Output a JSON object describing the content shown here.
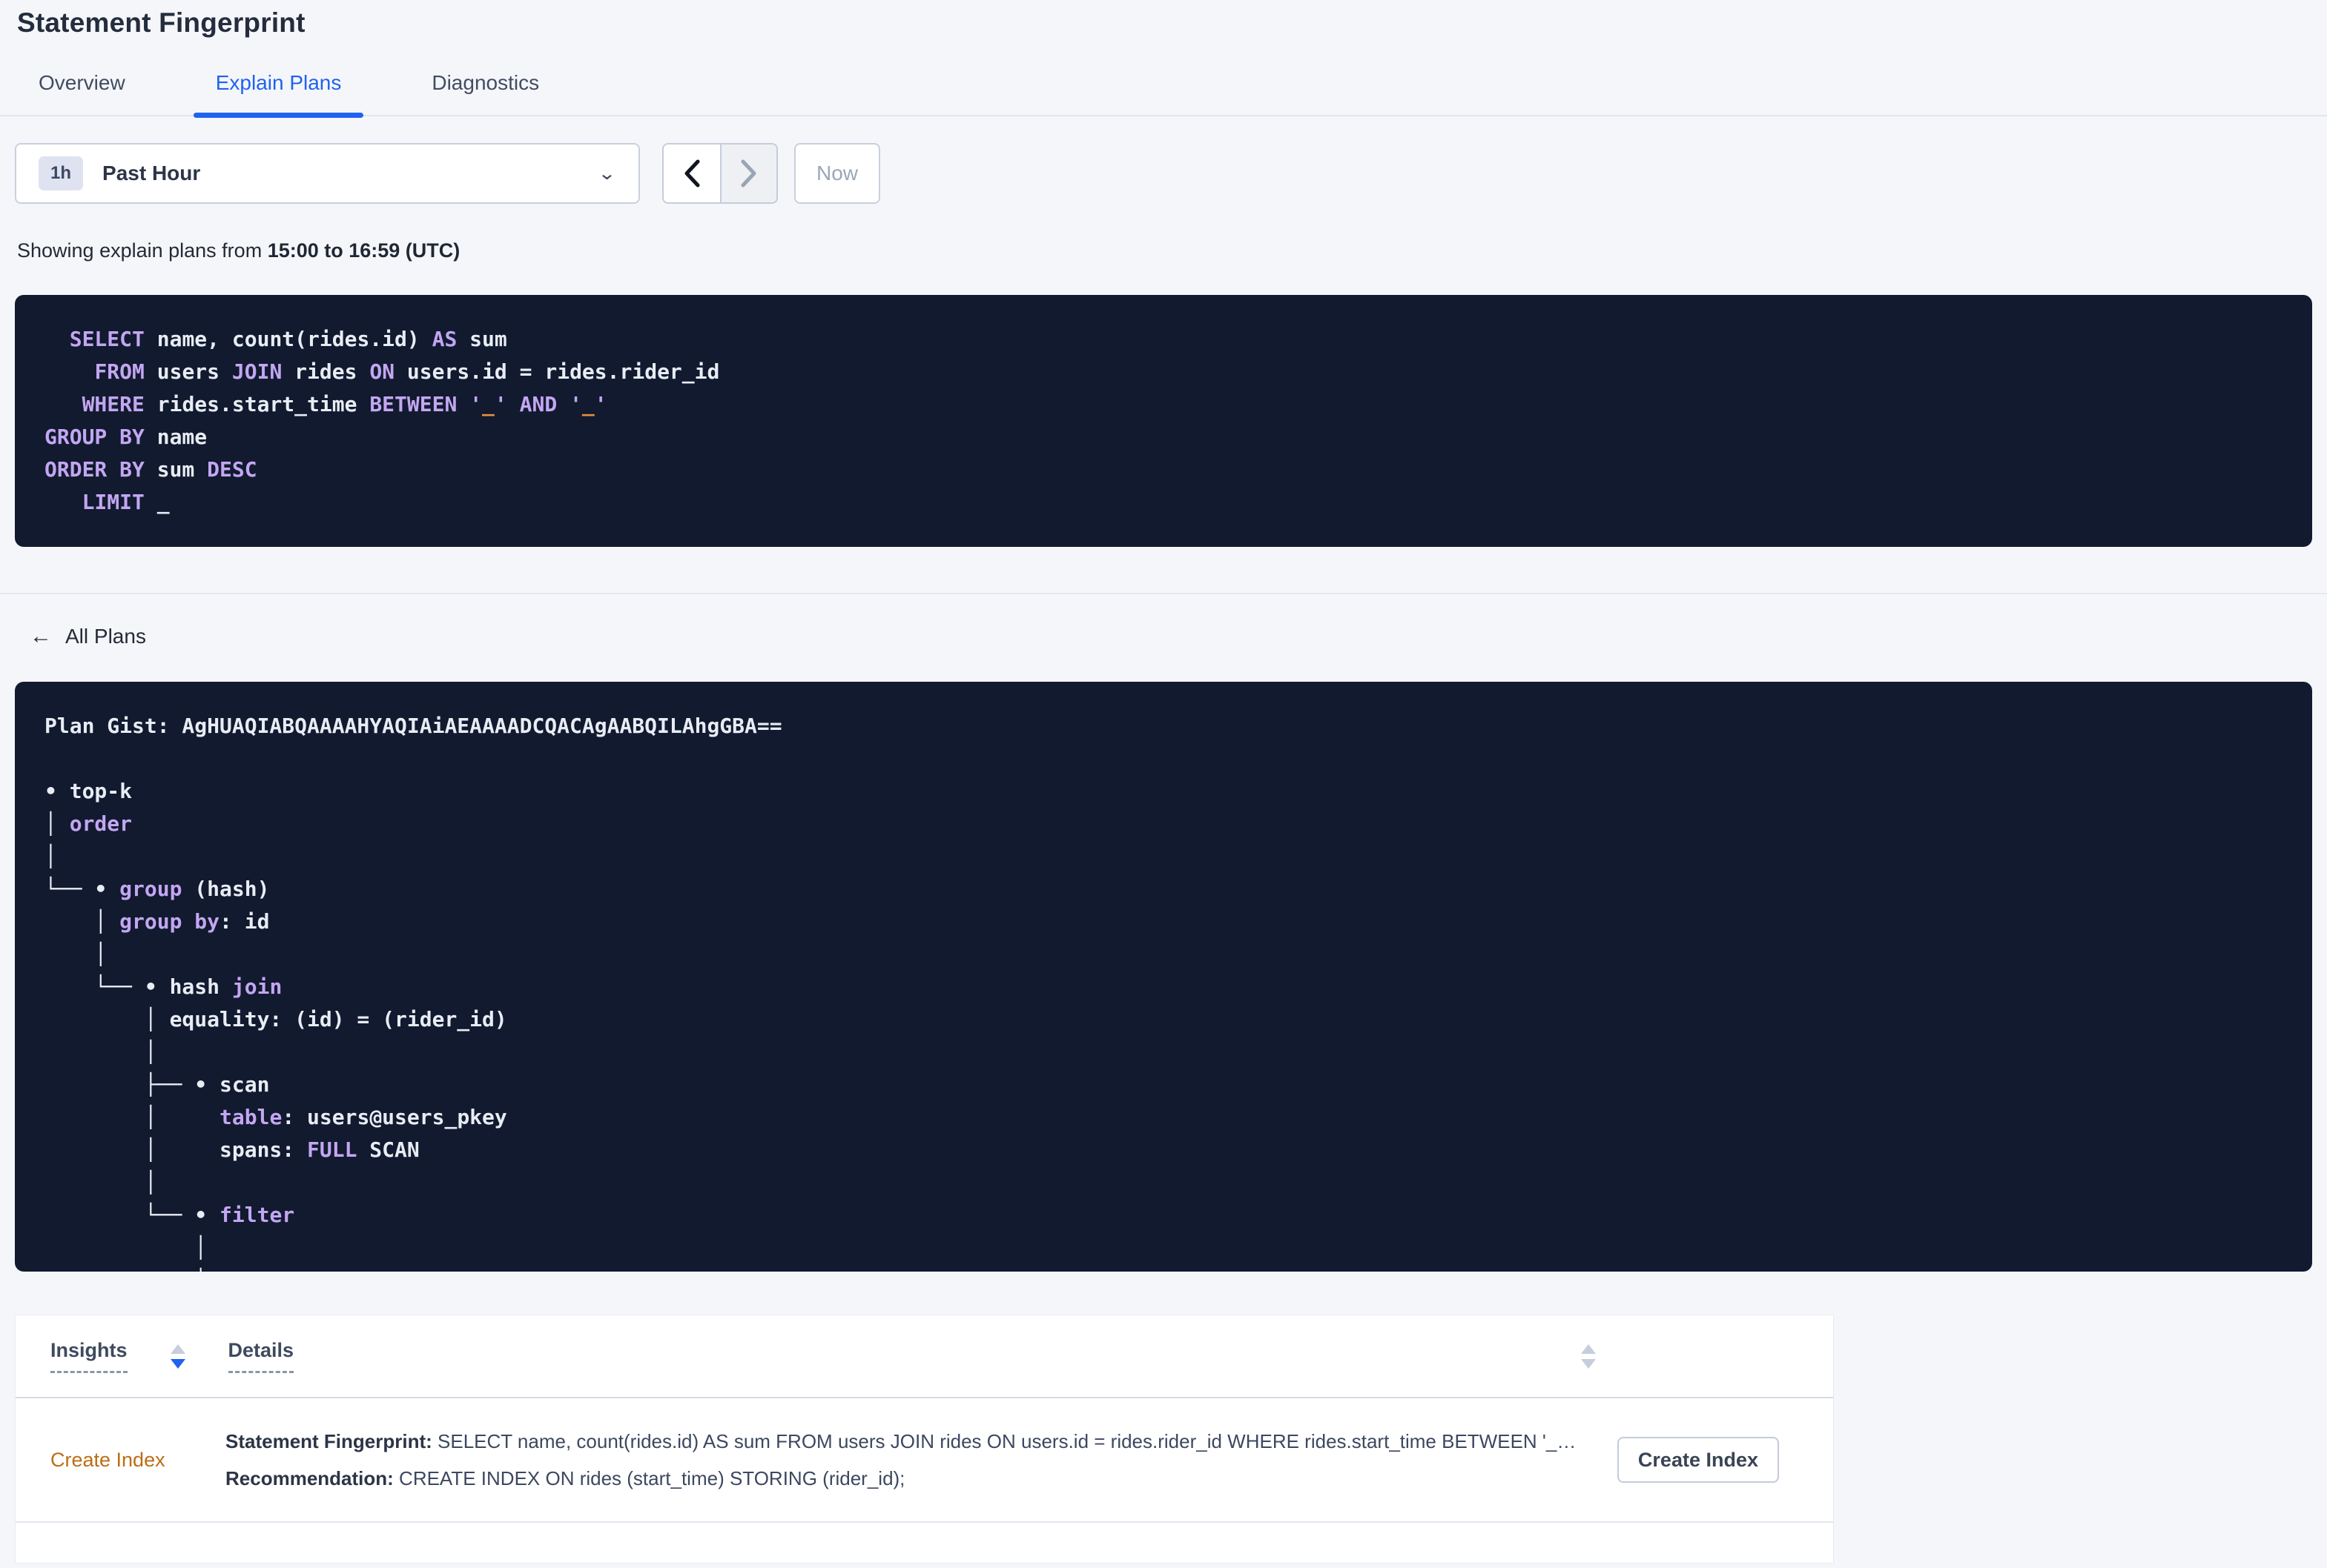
{
  "page_title": "Statement Fingerprint",
  "tabs": [
    {
      "label": "Overview",
      "active": false
    },
    {
      "label": "Explain Plans",
      "active": true
    },
    {
      "label": "Diagnostics",
      "active": false
    }
  ],
  "time_picker": {
    "badge": "1h",
    "label": "Past Hour",
    "now": "Now"
  },
  "showing": {
    "prefix": "Showing explain plans from ",
    "bold": "15:00 to 16:59 (UTC)"
  },
  "sql": {
    "lines": [
      [
        {
          "t": "  ",
          "c": "t"
        },
        {
          "t": "SELECT",
          "c": "k"
        },
        {
          "t": " name, count(rides.id) ",
          "c": "t"
        },
        {
          "t": "AS",
          "c": "k"
        },
        {
          "t": " sum",
          "c": "t"
        }
      ],
      [
        {
          "t": "    ",
          "c": "t"
        },
        {
          "t": "FROM",
          "c": "k"
        },
        {
          "t": " users ",
          "c": "t"
        },
        {
          "t": "JOIN",
          "c": "k"
        },
        {
          "t": " rides ",
          "c": "t"
        },
        {
          "t": "ON",
          "c": "k"
        },
        {
          "t": " users.id = rides.rider_id",
          "c": "t"
        }
      ],
      [
        {
          "t": "   ",
          "c": "t"
        },
        {
          "t": "WHERE",
          "c": "k"
        },
        {
          "t": " rides.start_time ",
          "c": "t"
        },
        {
          "t": "BETWEEN",
          "c": "k"
        },
        {
          "t": " ",
          "c": "t"
        },
        {
          "t": "'",
          "c": "k"
        },
        {
          "t": "_",
          "c": "l"
        },
        {
          "t": "'",
          "c": "k"
        },
        {
          "t": " ",
          "c": "t"
        },
        {
          "t": "AND",
          "c": "k"
        },
        {
          "t": " ",
          "c": "t"
        },
        {
          "t": "'",
          "c": "k"
        },
        {
          "t": "_",
          "c": "l"
        },
        {
          "t": "'",
          "c": "k"
        }
      ],
      [
        {
          "t": "GROUP BY",
          "c": "k"
        },
        {
          "t": " name",
          "c": "t"
        }
      ],
      [
        {
          "t": "ORDER BY",
          "c": "k"
        },
        {
          "t": " sum ",
          "c": "t"
        },
        {
          "t": "DESC",
          "c": "k"
        }
      ],
      [
        {
          "t": "   ",
          "c": "t"
        },
        {
          "t": "LIMIT",
          "c": "k"
        },
        {
          "t": " _",
          "c": "t"
        }
      ]
    ]
  },
  "all_plans": {
    "label": "All Plans",
    "back_icon": "arrow-left"
  },
  "plan": {
    "gist": "AgHUAQIABQAAAAHYAQIAiAEAAAADCQACAgAABQILAhgGBA==",
    "lines": [
      [
        {
          "t": "Plan Gist: AgHUAQIABQAAAAHYAQIAiAEAAAADCQACAgAABQILAhgGBA==",
          "c": "t"
        }
      ],
      [],
      [
        {
          "t": "• top-k",
          "c": "t"
        }
      ],
      [
        {
          "t": "│ ",
          "c": "t"
        },
        {
          "t": "order",
          "c": "k"
        }
      ],
      [
        {
          "t": "│",
          "c": "t"
        }
      ],
      [
        {
          "t": "└── • ",
          "c": "t"
        },
        {
          "t": "group",
          "c": "k"
        },
        {
          "t": " (hash)",
          "c": "t"
        }
      ],
      [
        {
          "t": "    │ ",
          "c": "t"
        },
        {
          "t": "group by",
          "c": "k"
        },
        {
          "t": ": id",
          "c": "t"
        }
      ],
      [
        {
          "t": "    │",
          "c": "t"
        }
      ],
      [
        {
          "t": "    └── • hash ",
          "c": "t"
        },
        {
          "t": "join",
          "c": "k"
        }
      ],
      [
        {
          "t": "        │ equality: (id) = (rider_id)",
          "c": "t"
        }
      ],
      [
        {
          "t": "        │",
          "c": "t"
        }
      ],
      [
        {
          "t": "        ├── • scan",
          "c": "t"
        }
      ],
      [
        {
          "t": "        │     ",
          "c": "t"
        },
        {
          "t": "table",
          "c": "k"
        },
        {
          "t": ": users@users_pkey",
          "c": "t"
        }
      ],
      [
        {
          "t": "        │     spans: ",
          "c": "t"
        },
        {
          "t": "FULL",
          "c": "k"
        },
        {
          "t": " SCAN",
          "c": "t"
        }
      ],
      [
        {
          "t": "        │",
          "c": "t"
        }
      ],
      [
        {
          "t": "        └── • ",
          "c": "t"
        },
        {
          "t": "filter",
          "c": "k"
        }
      ],
      [
        {
          "t": "            │",
          "c": "t"
        }
      ],
      [
        {
          "t": "            │",
          "c": "t"
        }
      ]
    ]
  },
  "insights_table": {
    "columns": [
      {
        "label": "Insights",
        "sort": "desc"
      },
      {
        "label": "Details",
        "sort": "none"
      }
    ],
    "rows": [
      {
        "insight": "Create Index",
        "fingerprint_label": "Statement Fingerprint:",
        "fingerprint": " SELECT name, count(rides.id) AS sum FROM users JOIN rides ON users.id = rides.rider_id WHERE rides.start_time BETWEEN '_…",
        "recommendation_label": "Recommendation:",
        "recommendation": " CREATE INDEX ON rides (start_time) STORING (rider_id);",
        "action": "Create Index"
      }
    ]
  },
  "colors": {
    "accent_blue": "#1f63f0",
    "insight_orange": "#bd6d15",
    "code_bg": "#111a2e",
    "code_text": "#e8ecf4",
    "code_keyword": "#c3a6f2",
    "code_literal": "#e59140"
  }
}
